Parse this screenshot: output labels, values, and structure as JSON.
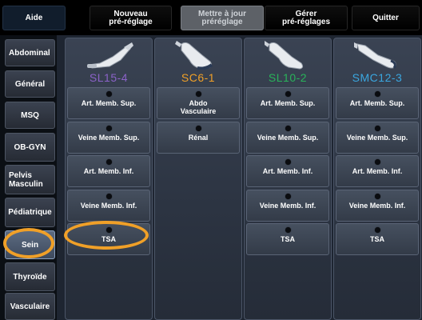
{
  "toolbar": {
    "aide": "Aide",
    "nouveau": "Nouveau\npré-réglage",
    "mettre_a_jour": "Mettre à jour\npréréglage",
    "gerer": "Gérer\npré-réglages",
    "quitter": "Quitter"
  },
  "sidebar": {
    "items": [
      "Abdominal",
      "Général",
      "MSQ",
      "OB-GYN",
      "Pelvis\nMasculin",
      "Pédiatrique",
      "Sein",
      "Thyroïde",
      "Vasculaire"
    ],
    "active": "Sein"
  },
  "probes": [
    {
      "name": "SL15-4",
      "color": "#8b62c8",
      "presets": [
        "Art. Memb. Sup.",
        "Veine Memb. Sup.",
        "Art. Memb. Inf.",
        "Veine Memb. Inf.",
        "TSA"
      ]
    },
    {
      "name": "SC6-1",
      "color": "#f0a028",
      "presets": [
        "Abdo\nVasculaire",
        "Rénal"
      ]
    },
    {
      "name": "SL10-2",
      "color": "#29b35a",
      "presets": [
        "Art. Memb. Sup.",
        "Veine Memb. Sup.",
        "Art. Memb. Inf.",
        "Veine Memb. Inf.",
        "TSA"
      ]
    },
    {
      "name": "SMC12-3",
      "color": "#3aa7e0",
      "presets": [
        "Art. Memb. Sup.",
        "Veine Memb. Sup.",
        "Art. Memb. Inf.",
        "Veine Memb. Inf.",
        "TSA"
      ]
    }
  ],
  "highlight_color": "#f0a028"
}
